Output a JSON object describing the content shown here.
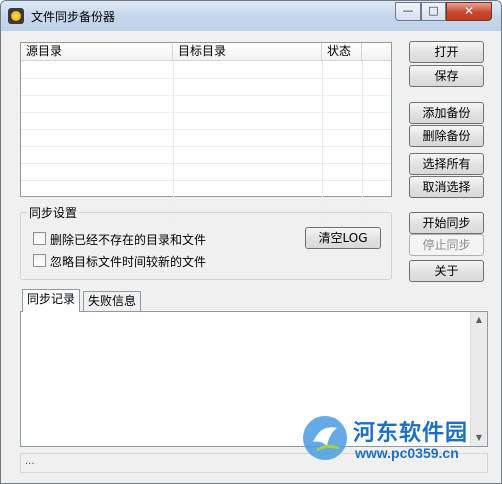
{
  "window": {
    "title": "文件同步备份器",
    "min_glyph": "—",
    "max_glyph": "□",
    "close_glyph": "✕"
  },
  "list": {
    "columns": [
      "源目录",
      "目标目录",
      "状态"
    ],
    "rows": []
  },
  "buttons": {
    "open": "打开",
    "save": "保存",
    "add_backup": "添加备份",
    "delete_backup": "删除备份",
    "select_all": "选择所有",
    "cancel_select": "取消选择",
    "start_sync": "开始同步",
    "stop_sync": "停止同步",
    "about": "关于"
  },
  "sync_settings": {
    "label": "同步设置",
    "option1": "删除已经不存在的目录和文件",
    "option1_checked": false,
    "option2": "忽略目标文件时间较新的文件",
    "option2_checked": false,
    "clear_log": "清空LOG"
  },
  "tabs": {
    "log": "同步记录",
    "failed": "失败信息",
    "active": "log"
  },
  "status": {
    "text": "..."
  },
  "watermark": {
    "title": "河东软件园",
    "url": "www.pc0359.cn"
  },
  "colors": {
    "watermark": "#1d6fc6",
    "window_bg": "#f0f0f0",
    "close_button": "#c8462e"
  }
}
